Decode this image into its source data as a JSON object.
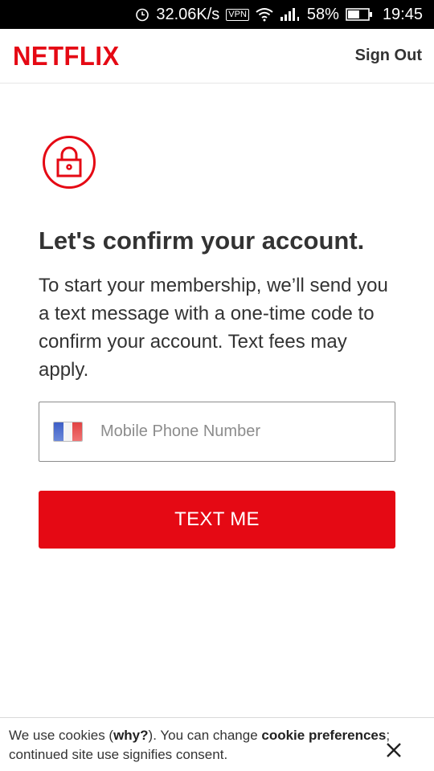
{
  "status_bar": {
    "alarm_icon": "alarm-clock-icon",
    "network_speed": "32.06K/s",
    "vpn_label": "VPN",
    "wifi_icon": "wifi-icon",
    "signal_icon": "signal-icon",
    "battery_percent": "58%",
    "battery_level": 0.58,
    "time": "19:45"
  },
  "header": {
    "logo_text": "NETFLIX",
    "sign_out_label": "Sign Out"
  },
  "main": {
    "icon": "lock-icon",
    "title": "Let's confirm your account.",
    "description": "To start your membership, we’ll send you a text message with a one-time code to confirm your account. Text fees may apply.",
    "phone_field": {
      "country_flag": "france-flag-icon",
      "placeholder": "Mobile Phone Number",
      "value": ""
    },
    "submit_label": "TEXT ME"
  },
  "cookie_banner": {
    "text_prefix": "We use cookies (",
    "why_link": "why?",
    "text_middle": "). You can change ",
    "preferences_link": "cookie preferences",
    "text_suffix": "; continued site use signifies consent.",
    "close_icon": "close-icon"
  },
  "colors": {
    "brand_red": "#e50914",
    "text_dark": "#333333",
    "status_bar_bg": "#000000"
  }
}
